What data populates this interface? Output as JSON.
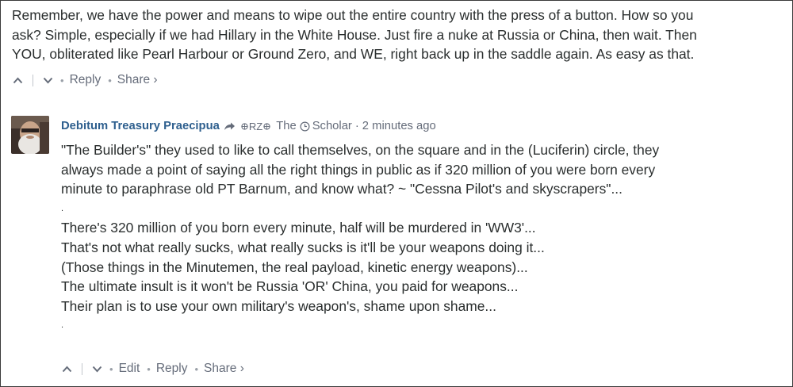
{
  "parent_comment": {
    "body_lines": [
      "Remember, we have the power and means to wipe out the entire country with the press of a button. How so you",
      "ask? Simple, especially if we had Hillary in the White House. Just fire a nuke at Russia or China, then wait. Then",
      "YOU, obliterated like Pearl Harbour or Ground Zero, and WE, right back up in the saddle again. As easy as that."
    ],
    "actions": {
      "reply": "Reply",
      "share": "Share ›"
    }
  },
  "reply_comment": {
    "author": "Debitum Treasury Praecipua",
    "badge": "RZ",
    "in_reply_prefix": "The",
    "in_reply_to": "Scholar",
    "separator": "·",
    "timestamp": "2 minutes ago",
    "body_lines": [
      "\"The Builder's\" they used to like to call themselves, on the square and in the (Luciferin) circle, they",
      "always made a point of saying all the right things in public as if 320 million of you were born every",
      "minute to paraphrase old PT Barnum, and know what? ~ \"Cessna Pilot's and skyscrapers\"...",
      ".",
      "There's 320 million of you born every minute, half will be murdered in 'WW3'...",
      "That's not what really sucks, what really sucks is it'll be your weapons doing it...",
      "(Those things in the Minutemen, the real payload, kinetic energy weapons)...",
      "The ultimate insult is it won't be Russia 'OR' China, you paid for weapons...",
      "Their plan is to use your own military's weapon's, shame upon shame...",
      "."
    ],
    "actions": {
      "edit": "Edit",
      "reply": "Reply",
      "share": "Share ›"
    }
  },
  "icons": {
    "upvote": "chevron-up-icon",
    "downvote": "chevron-down-icon",
    "share_arrow": "share-arrow-icon",
    "badge": "globe-icon",
    "clock": "clock-icon"
  },
  "colors": {
    "text": "#2a2e2e",
    "muted": "#656c7a",
    "author_link": "#2e5f8e",
    "border": "#3a3a3a"
  }
}
